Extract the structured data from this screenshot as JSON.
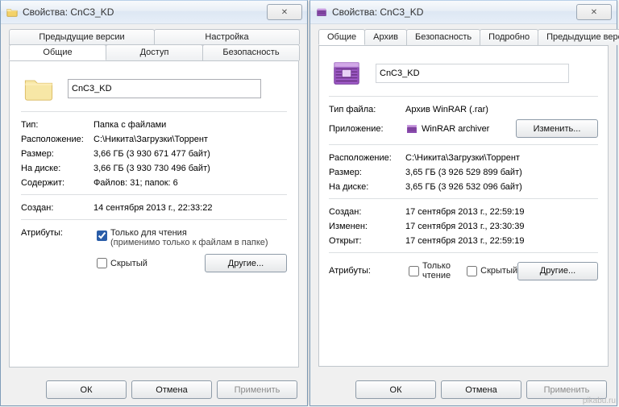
{
  "watermark": "pikabu.ru",
  "left": {
    "title": "Свойства: CnC3_KD",
    "close_glyph": "✕",
    "tabs_upper": {
      "prev": "Предыдущие версии",
      "settings": "Настройка"
    },
    "tabs_lower": {
      "general": "Общие",
      "access": "Доступ",
      "security": "Безопасность"
    },
    "name": "CnC3_KD",
    "fields": {
      "type_lbl": "Тип:",
      "type_val": "Папка с файлами",
      "loc_lbl": "Расположение:",
      "loc_val": "C:\\Никита\\Загрузки\\Торрент",
      "size_lbl": "Размер:",
      "size_val": "3,66 ГБ (3 930 671 477 байт)",
      "disk_lbl": "На диске:",
      "disk_val": "3,66 ГБ (3 930 730 496 байт)",
      "cont_lbl": "Содержит:",
      "cont_val": "Файлов: 31; папок: 6",
      "created_lbl": "Создан:",
      "created_val": "14 сентября 2013 г., 22:33:22",
      "attr_lbl": "Атрибуты:",
      "readonly_label": "Только для чтения",
      "readonly_note": "(применимо только к файлам в папке)",
      "hidden_label": "Скрытый",
      "other_btn": "Другие...",
      "ok": "ОК",
      "cancel": "Отмена",
      "apply": "Применить"
    }
  },
  "right": {
    "title": "Свойства: CnC3_KD",
    "close_glyph": "✕",
    "tabs": {
      "general": "Общие",
      "archive": "Архив",
      "security": "Безопасность",
      "details": "Подробно",
      "prev": "Предыдущие версии"
    },
    "name": "CnC3_KD",
    "fields": {
      "ftype_lbl": "Тип файла:",
      "ftype_val": "Архив WinRAR (.rar)",
      "app_lbl": "Приложение:",
      "app_val": "WinRAR archiver",
      "change_btn": "Изменить...",
      "loc_lbl": "Расположение:",
      "loc_val": "C:\\Никита\\Загрузки\\Торрент",
      "size_lbl": "Размер:",
      "size_val": "3,65 ГБ (3 926 529 899 байт)",
      "disk_lbl": "На диске:",
      "disk_val": "3,65 ГБ (3 926 532 096 байт)",
      "created_lbl": "Создан:",
      "created_val": "17 сентября 2013 г., 22:59:19",
      "mod_lbl": "Изменен:",
      "mod_val": "17 сентября 2013 г., 23:30:39",
      "open_lbl": "Открыт:",
      "open_val": "17 сентября 2013 г., 22:59:19",
      "attr_lbl": "Атрибуты:",
      "readonly_label": "Только чтение",
      "hidden_label": "Скрытый",
      "other_btn": "Другие...",
      "ok": "ОК",
      "cancel": "Отмена",
      "apply": "Применить"
    }
  }
}
